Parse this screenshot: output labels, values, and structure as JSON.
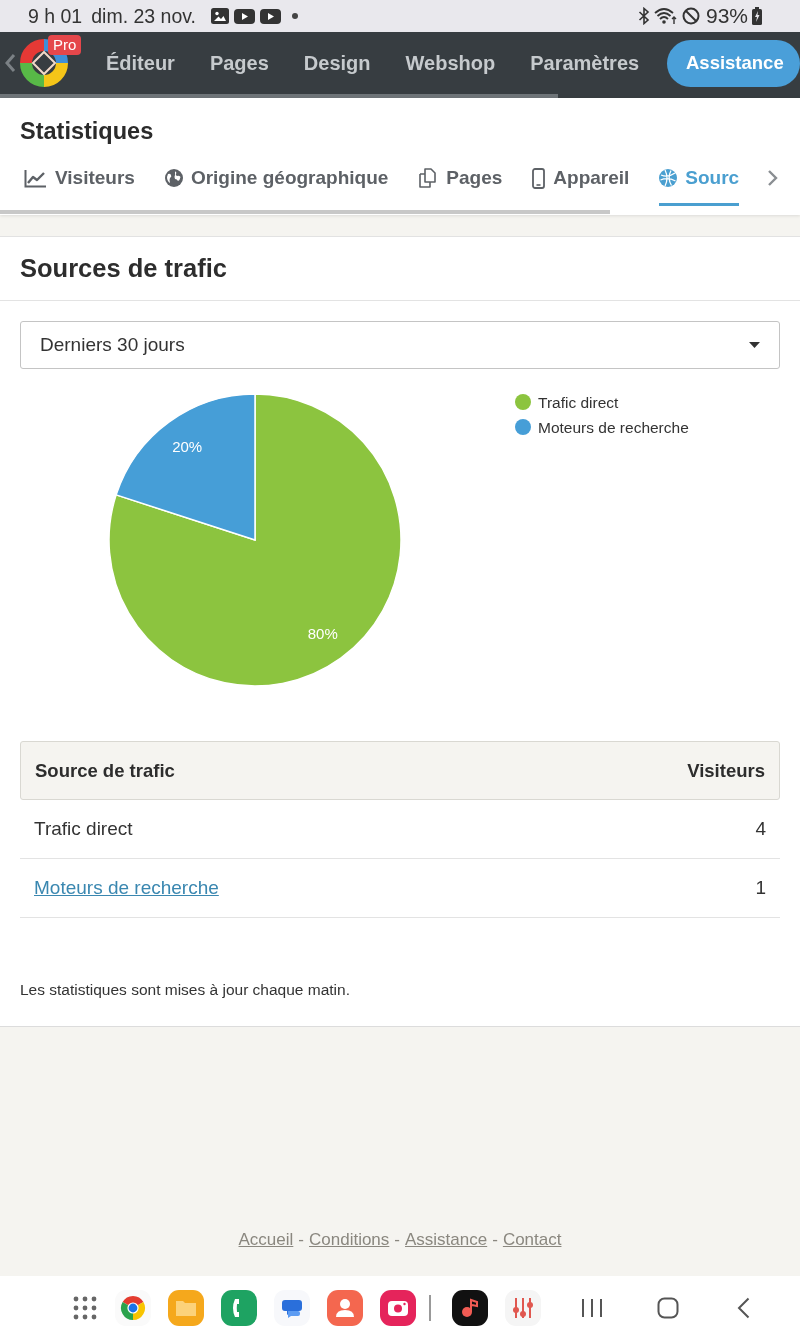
{
  "status_bar": {
    "time": "9 h 01",
    "date": "dim. 23 nov.",
    "battery": "93%"
  },
  "top_nav": {
    "badge": "Pro",
    "items": [
      "Éditeur",
      "Pages",
      "Design",
      "Webshop",
      "Paramètres"
    ],
    "button": "Assistance"
  },
  "header": {
    "title": "Statistiques",
    "tabs": [
      {
        "label": "Visiteurs",
        "selected": false
      },
      {
        "label": "Origine géographique",
        "selected": false
      },
      {
        "label": "Pages",
        "selected": false
      },
      {
        "label": "Appareil",
        "selected": false
      },
      {
        "label": "Sourc",
        "selected": true
      }
    ]
  },
  "panel": {
    "title": "Sources de trafic",
    "period_select": {
      "value": "Derniers 30 jours"
    },
    "chart_data": {
      "type": "pie",
      "categories": [
        "Trafic direct",
        "Moteurs de recherche"
      ],
      "values": [
        80,
        20
      ],
      "colors": [
        "#8cc43f",
        "#469ed7"
      ],
      "value_labels": [
        "80%",
        "20%"
      ],
      "legend": "right"
    },
    "table": {
      "columns": [
        "Source de trafic",
        "Visiteurs"
      ],
      "rows": [
        {
          "source": "Trafic direct",
          "link": false,
          "visitors": "4"
        },
        {
          "source": "Moteurs de recherche",
          "link": true,
          "visitors": "1"
        }
      ]
    },
    "note": "Les statistiques sont mises à jour chaque matin."
  },
  "footer": {
    "links": [
      {
        "kind": "link",
        "text": "Accueil"
      },
      {
        "kind": "separator",
        "text": "-"
      },
      {
        "kind": "link",
        "text": "Conditions"
      },
      {
        "kind": "separator",
        "text": "-"
      },
      {
        "kind": "link",
        "text": "Assistance"
      },
      {
        "kind": "separator",
        "text": "-"
      },
      {
        "kind": "link",
        "text": "Contact"
      }
    ]
  }
}
